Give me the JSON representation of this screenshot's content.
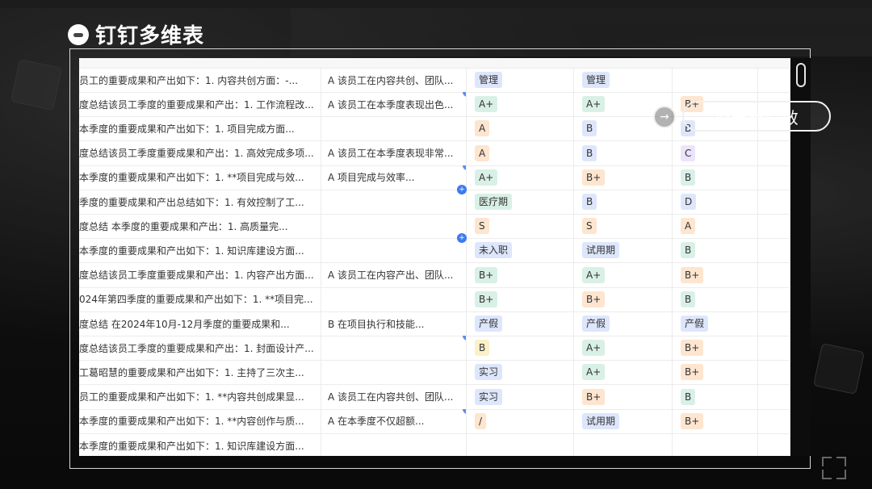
{
  "app": {
    "title": "钉钉多维表"
  },
  "ai_button": {
    "label": "AI分析绩效"
  },
  "table": {
    "rows": [
      {
        "summary": "员工的重要成果和产出如下：1. 内容共创方面：-...",
        "eval": "A 该员工在内容共创、团队...",
        "q1": {
          "text": "管理",
          "color": "b"
        },
        "q2": {
          "text": "管理",
          "color": "b"
        },
        "q3": {
          "text": "",
          "color": ""
        },
        "marker": false,
        "plus": false
      },
      {
        "summary": "度总结该员工季度的重要成果和产出：1. 工作流程改...",
        "eval": "A 该员工在本季度表现出色...",
        "q1": {
          "text": "A+",
          "color": "g"
        },
        "q2": {
          "text": "A+",
          "color": "g"
        },
        "q3": {
          "text": "B+",
          "color": "o"
        },
        "marker": true,
        "plus": false
      },
      {
        "summary": "本季度的重要成果和产出如下：1. 项目完成方面...",
        "eval": "",
        "q1": {
          "text": "A",
          "color": "o"
        },
        "q2": {
          "text": "B",
          "color": "b"
        },
        "q3": {
          "text": "B",
          "color": "b"
        },
        "marker": false,
        "plus": false
      },
      {
        "summary": "度总结该员工季度重要成果和产出：1. 高效完成多项...",
        "eval": "A 该员工在本季度表现非常...",
        "q1": {
          "text": "A",
          "color": "o"
        },
        "q2": {
          "text": "B",
          "color": "b"
        },
        "q3": {
          "text": "C",
          "color": "p"
        },
        "marker": false,
        "plus": false
      },
      {
        "summary": "本季度的重要成果和产出如下：1. **项目完成与效...",
        "eval": "A 项目完成与效率...",
        "q1": {
          "text": "A+",
          "color": "g"
        },
        "q2": {
          "text": "B+",
          "color": "o"
        },
        "q3": {
          "text": "B",
          "color": "g"
        },
        "marker": true,
        "plus": false
      },
      {
        "summary": "季度的重要成果和产出总结如下：1. 有效控制了工...",
        "eval": "",
        "q1": {
          "text": "医疗期",
          "color": "g"
        },
        "q2": {
          "text": "B",
          "color": "b"
        },
        "q3": {
          "text": "D",
          "color": "b"
        },
        "marker": false,
        "plus": true
      },
      {
        "summary": "度总结 本季度的重要成果和产出：1. 高质量完...",
        "eval": "",
        "q1": {
          "text": "S",
          "color": "o"
        },
        "q2": {
          "text": "S",
          "color": "o"
        },
        "q3": {
          "text": "A",
          "color": "o"
        },
        "marker": false,
        "plus": false
      },
      {
        "summary": "本季度的重要成果和产出如下：1. 知识库建设方面...",
        "eval": "",
        "q1": {
          "text": "未入职",
          "color": "b"
        },
        "q2": {
          "text": "试用期",
          "color": "b"
        },
        "q3": {
          "text": "B",
          "color": "g"
        },
        "marker": false,
        "plus": true
      },
      {
        "summary": "度总结该员工季度重要成果和产出：1. 内容产出方面...",
        "eval": "A 该员工在内容产出、团队...",
        "q1": {
          "text": "B+",
          "color": "g"
        },
        "q2": {
          "text": "A+",
          "color": "g"
        },
        "q3": {
          "text": "B+",
          "color": "o"
        },
        "marker": false,
        "plus": false
      },
      {
        "summary": "024年第四季度的重要成果和产出如下：1. **项目完...",
        "eval": "",
        "q1": {
          "text": "B+",
          "color": "g"
        },
        "q2": {
          "text": "B+",
          "color": "o"
        },
        "q3": {
          "text": "B",
          "color": "g"
        },
        "marker": false,
        "plus": false
      },
      {
        "summary": "度总结 在2024年10月-12月季度的重要成果和...",
        "eval": "B 在项目执行和技能...",
        "q1": {
          "text": "产假",
          "color": "b"
        },
        "q2": {
          "text": "产假",
          "color": "b"
        },
        "q3": {
          "text": "产假",
          "color": "b"
        },
        "marker": false,
        "plus": false
      },
      {
        "summary": "度总结该员工季度的重要成果和产出：1. 封面设计产...",
        "eval": "",
        "q1": {
          "text": "B",
          "color": "y"
        },
        "q2": {
          "text": "A+",
          "color": "g"
        },
        "q3": {
          "text": "B+",
          "color": "o"
        },
        "marker": true,
        "plus": false
      },
      {
        "summary": "工葛昭慧的重要成果和产出如下：1. 主持了三次主...",
        "eval": "",
        "q1": {
          "text": "实习",
          "color": "b"
        },
        "q2": {
          "text": "A+",
          "color": "g"
        },
        "q3": {
          "text": "B+",
          "color": "o"
        },
        "marker": false,
        "plus": false
      },
      {
        "summary": "员工的重要成果和产出如下：1. **内容共创成果显...",
        "eval": "A 该员工在内容共创、团队...",
        "q1": {
          "text": "实习",
          "color": "b"
        },
        "q2": {
          "text": "B+",
          "color": "o"
        },
        "q3": {
          "text": "B",
          "color": "g"
        },
        "marker": false,
        "plus": false
      },
      {
        "summary": "本季度的重要成果和产出如下：1. **内容创作与质...",
        "eval": "A 在本季度不仅超额...",
        "q1": {
          "text": "/",
          "color": "o"
        },
        "q2": {
          "text": "试用期",
          "color": "b"
        },
        "q3": {
          "text": "B+",
          "color": "o"
        },
        "marker": true,
        "plus": false
      },
      {
        "summary": "本季度的重要成果和产出如下：1. 知识库建设方面...",
        "eval": "",
        "q1": {
          "text": "",
          "color": ""
        },
        "q2": {
          "text": "",
          "color": ""
        },
        "q3": {
          "text": "",
          "color": ""
        },
        "marker": false,
        "plus": false
      }
    ]
  },
  "icons": {
    "logo": "dingtalk-logo-icon",
    "arrow": "arrow-right-circle-icon"
  }
}
